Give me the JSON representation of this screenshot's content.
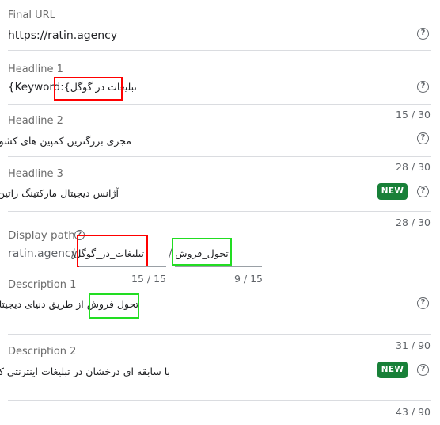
{
  "final_url": {
    "label": "Final URL",
    "value": "https://ratin.agency"
  },
  "headline1": {
    "label": "Headline 1",
    "value_prefix": "{Keyword:",
    "value_keyword": "تبلیغات در گوگل}",
    "counter": "15 / 30"
  },
  "headline2": {
    "label": "Headline 2",
    "value": "مجری بزرگترین کمپین های کشور",
    "counter": "28 / 30"
  },
  "headline3": {
    "label": "Headline 3",
    "value": "آژانس دیجیتال مارکتینگ راتین",
    "badge": "NEW",
    "counter": "28 / 30"
  },
  "display_path": {
    "label": "Display path",
    "domain": "ratin.agency",
    "separator1": "/",
    "path1": "تبلیغات_در_گوگل",
    "separator2": "/",
    "path2": "تحول_فروش",
    "counter1": "15 / 15",
    "counter2": "9 / 15"
  },
  "description1": {
    "label": "Description 1",
    "value_highlight": "تحول فروش",
    "value_rest": "از طریق دنیای دیجیتال",
    "counter": "31 / 90"
  },
  "description2": {
    "label": "Description 2",
    "value": "با سابقه ای درخشان در تبلیغات اینترنتی کشور",
    "badge": "NEW",
    "counter": "43 / 90"
  },
  "colors": {
    "badge_green": "#188038",
    "annotation_red": "#ff0000",
    "annotation_green": "#22dd22"
  },
  "icons": [
    "help-icon"
  ]
}
